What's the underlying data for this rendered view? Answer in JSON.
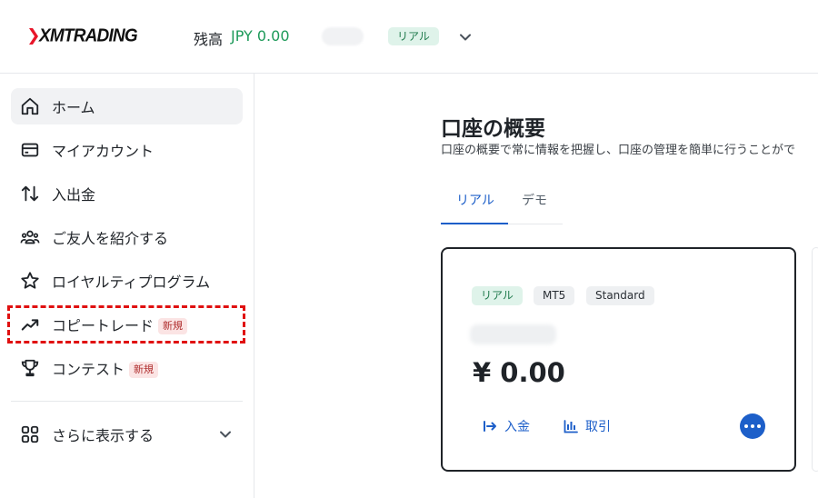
{
  "header": {
    "logo_text": "XMTRADING",
    "balance_label": "残高",
    "balance_value": "JPY 0.00",
    "account_badge": "リアル"
  },
  "sidebar": {
    "items": [
      {
        "label": "ホーム",
        "icon": "home-icon"
      },
      {
        "label": "マイアカウント",
        "icon": "card-icon"
      },
      {
        "label": "入出金",
        "icon": "transfer-arrows-icon"
      },
      {
        "label": "ご友人を紹介する",
        "icon": "people-icon"
      },
      {
        "label": "ロイヤルティプログラム",
        "icon": "star-icon"
      },
      {
        "label": "コピートレード",
        "icon": "trending-up-icon",
        "badge": "新規"
      },
      {
        "label": "コンテスト",
        "icon": "trophy-icon",
        "badge": "新規"
      },
      {
        "label": "さらに表示する",
        "icon": "grid-icon"
      }
    ]
  },
  "main": {
    "title": "口座の概要",
    "subtitle": "口座の概要で常に情報を把握し、口座の管理を簡単に行うことがで",
    "tabs": [
      {
        "label": "リアル",
        "active": true
      },
      {
        "label": "デモ",
        "active": false
      }
    ],
    "card": {
      "chips": [
        "リアル",
        "MT5",
        "Standard"
      ],
      "amount": "¥ 0.00",
      "deposit_label": "入金",
      "history_label": "取引"
    }
  },
  "colors": {
    "accent": "#1d5fc9",
    "positive": "#1e9a5a",
    "highlight": "#e01010"
  }
}
